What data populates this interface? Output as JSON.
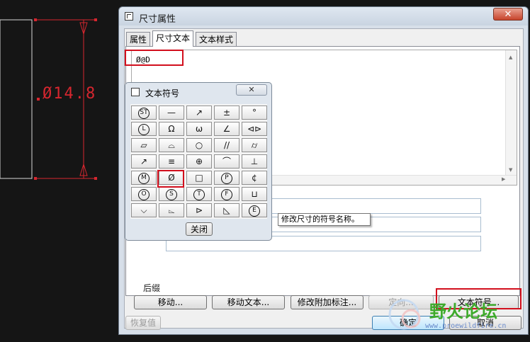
{
  "cad": {
    "dimension_text": "Ø14.8"
  },
  "dialog": {
    "title": "尺寸属性",
    "close_glyph": "✕",
    "tabs": [
      "属性",
      "尺寸文本",
      "文本样式"
    ],
    "text_value": "Ø@D",
    "suffix_label": "后缀",
    "buttons": {
      "move": "移动...",
      "move_text": "移动文本...",
      "modify_attached": "修改附加标注...",
      "orient": "定向...",
      "text_symbol": "文本符号...",
      "restore": "恢复值",
      "ok": "确定",
      "cancel": "取消"
    }
  },
  "symbol_popup": {
    "title": "文本符号",
    "close_glyph": "✕",
    "symbols": [
      [
        "ST",
        "—",
        "↗",
        "±",
        "°"
      ],
      [
        "L",
        "Ω",
        "ω",
        "∠",
        "⊲⊳"
      ],
      [
        "▱",
        "⌓",
        "○",
        "//",
        "⌭"
      ],
      [
        "↗",
        "≡",
        "⊕",
        "⌒",
        "⊥"
      ],
      [
        "M",
        "Ø",
        "□",
        "P",
        "¢"
      ],
      [
        "O",
        "S",
        "T",
        "F",
        "⊔"
      ],
      [
        "⌵",
        "⌳",
        "⊳",
        "◺",
        "E"
      ]
    ],
    "close_button": "关闭"
  },
  "tooltip": "修改尺寸的符号名称。",
  "watermark": {
    "text": "野火论坛",
    "url": "www.proewildfire.cn"
  },
  "colors": {
    "highlight": "#d20f1d",
    "cad_line": "#d6262f"
  }
}
